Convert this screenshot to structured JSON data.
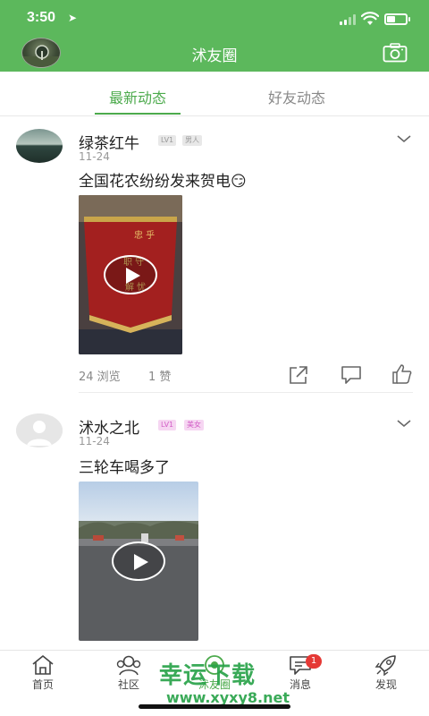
{
  "status_bar": {
    "time": "3:50",
    "battery_level": 0.45
  },
  "header": {
    "title": "沭友圈"
  },
  "tabs": [
    {
      "label": "最新动态",
      "active": true
    },
    {
      "label": "好友动态",
      "active": false
    }
  ],
  "posts": [
    {
      "user": "绿茶红牛",
      "level": "LV1",
      "tag": "男人",
      "date": "11-24",
      "text": "全国花农纷纷发来贺电😏",
      "views": "24 浏览",
      "likes": "1 赞"
    },
    {
      "user": "沭水之北",
      "level": "LV1",
      "tag": "美女",
      "date": "11-24",
      "text": "三轮车喝多了"
    }
  ],
  "bottom_nav": [
    {
      "label": "首页",
      "icon": "home-icon"
    },
    {
      "label": "社区",
      "icon": "community-icon"
    },
    {
      "label": "沭友圈",
      "icon": "friends-circle-icon"
    },
    {
      "label": "消息",
      "icon": "message-icon",
      "badge": "1"
    },
    {
      "label": "发现",
      "icon": "rocket-icon"
    }
  ],
  "watermark": {
    "line1": "幸运下载",
    "line2": "www.xyxy8.net"
  },
  "colors": {
    "brand_green": "#5cb85c",
    "tab_active": "#4caa4c",
    "badge_red": "#e53935"
  }
}
